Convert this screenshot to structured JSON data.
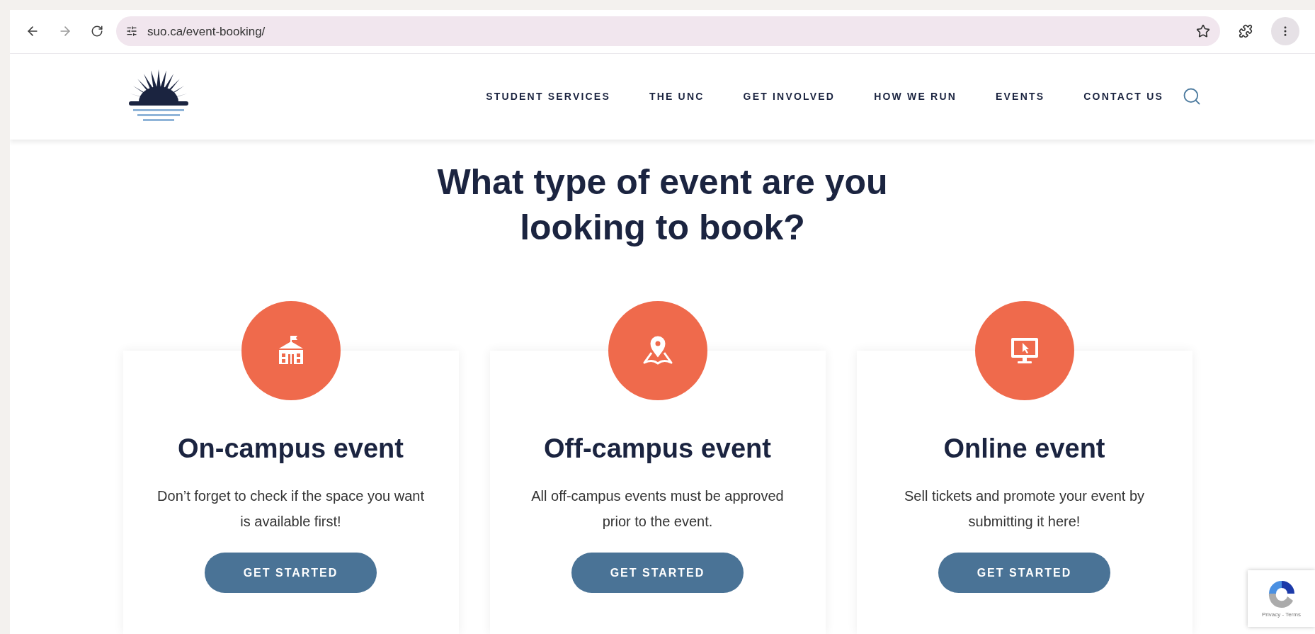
{
  "browser": {
    "url": "suo.ca/event-booking/"
  },
  "nav": {
    "items": [
      "STUDENT SERVICES",
      "THE UNC",
      "GET INVOLVED",
      "HOW WE RUN",
      "EVENTS",
      "CONTACT US"
    ]
  },
  "heading": "What type of event are you looking to book?",
  "cards": [
    {
      "kind": "school",
      "title": "On-campus event",
      "text": "Don’t forget to check if the space you want is available first!",
      "button": "GET STARTED"
    },
    {
      "kind": "map",
      "title": "Off-campus event",
      "text": "All off-campus events must be approved prior to the event.",
      "button": "GET STARTED"
    },
    {
      "kind": "monitor",
      "title": "Online event",
      "text": "Sell tickets and promote your event by submitting it here!",
      "button": "GET STARTED"
    }
  ],
  "recaptcha": {
    "links": "Privacy - Terms"
  }
}
